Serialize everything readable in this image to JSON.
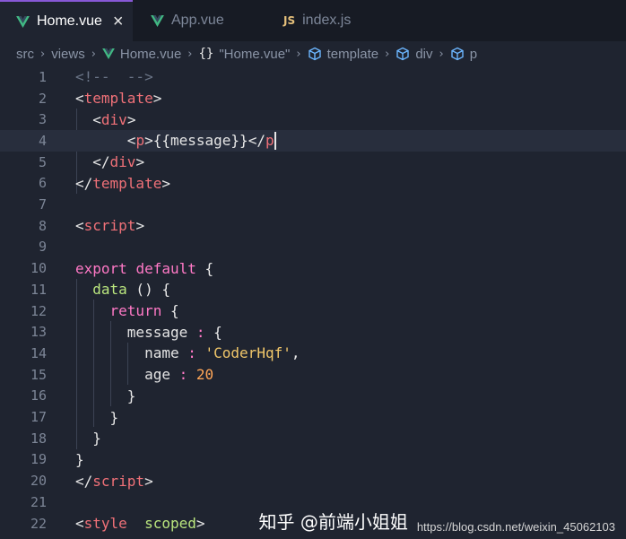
{
  "tabs": [
    {
      "label": "Home.vue",
      "icon": "vue-icon",
      "active": true,
      "close": "×"
    },
    {
      "label": "App.vue",
      "icon": "vue-icon",
      "active": false
    },
    {
      "label": "index.js",
      "icon": "js-icon",
      "icon_text": "JS",
      "active": false
    }
  ],
  "breadcrumb": {
    "src": "src",
    "views": "views",
    "file": "Home.vue",
    "braces": "{}",
    "component": "\"Home.vue\"",
    "template": "template",
    "div": "div",
    "p": "p"
  },
  "editor": {
    "line_numbers": [
      "1",
      "2",
      "3",
      "4",
      "5",
      "6",
      "7",
      "8",
      "9",
      "10",
      "11",
      "12",
      "13",
      "14",
      "15",
      "16",
      "17",
      "18",
      "19",
      "20",
      "21",
      "22"
    ],
    "current_line": 4
  },
  "watermark": {
    "zhihu": "知乎 @前端小姐姐",
    "url": "https://blog.csdn.net/weixin_45062103"
  },
  "colors": {
    "background": "#1f2430",
    "tabbar": "#171b24",
    "active_tab_border": "#8758d6",
    "vue_green": "#41b883",
    "tag": "#f07178",
    "keyword": "#ff79c6",
    "string": "#f1c76a",
    "number": "#ffa657"
  }
}
